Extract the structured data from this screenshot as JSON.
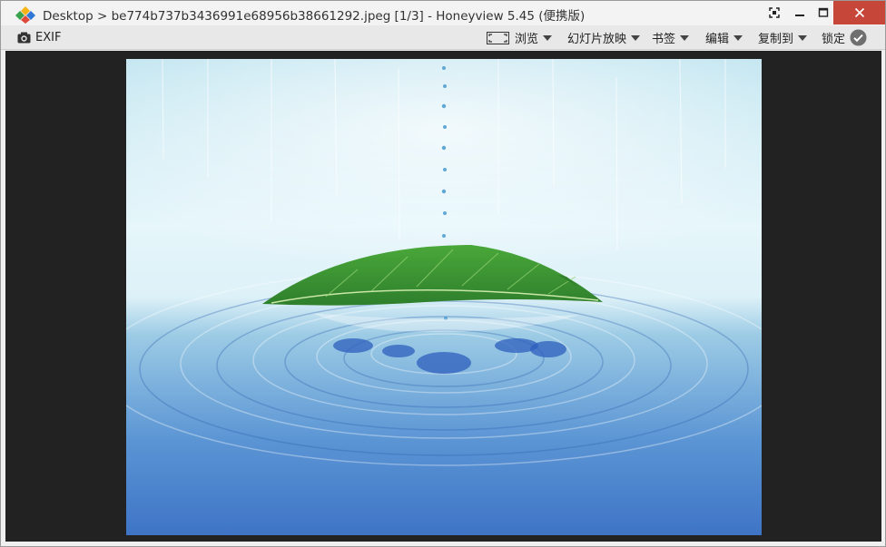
{
  "window": {
    "title": "Desktop > be774b737b3436991e68956b38661292.jpeg [1/3] - Honeyview 5.45 (便携版)"
  },
  "toolbar": {
    "exif_label": "EXIF",
    "browse_label": "浏览",
    "slideshow_label": "幻灯片放映",
    "bookmark_label": "书签",
    "edit_label": "编辑",
    "copyto_label": "复制到",
    "lock_label": "锁定"
  },
  "icons": {
    "app": "honeyview-logo-icon",
    "exif": "camera-icon",
    "browse": "frame-icon",
    "lock": "checkmark-circle-icon"
  },
  "colors": {
    "close_button": "#c7463a",
    "viewer_background": "#222222",
    "toolbar_background": "#e8e8e8"
  }
}
